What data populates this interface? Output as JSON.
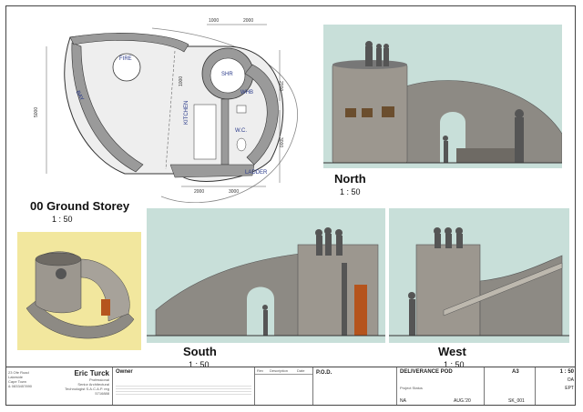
{
  "views": {
    "plan": {
      "title": "00 Ground Storey",
      "scale": "1 : 50"
    },
    "north": {
      "title": "North",
      "scale": "1 : 50"
    },
    "south": {
      "title": "South",
      "scale": "1 : 50"
    },
    "west": {
      "title": "West",
      "scale": "1 : 50"
    }
  },
  "plan_labels": {
    "fire": "FIRE",
    "shr": "SHR",
    "whb": "WHB",
    "wc": "W.C.",
    "kitchen": "KITCHEN",
    "ladder": "LADDER",
    "bay": "BAY"
  },
  "plan_dims": {
    "d1000_top": "1000",
    "d2000_top": "2000",
    "d1000_left": "1000",
    "d2000_right": "2000",
    "d3000_right": "3000",
    "d5000_left": "5000",
    "d3000_bottom": "3000",
    "d2000_bottom": "2000"
  },
  "title_block": {
    "name": "Eric Turck",
    "role1": "Professional",
    "role2": "Senior Architectural",
    "role3": "Technologist S.A.C.A.P. reg",
    "reg_no": "5716888",
    "address": [
      "23 Ofe Road",
      "Lakeside",
      "Cape Town",
      "& 0833457890"
    ],
    "owner_label": "Owner",
    "rev_headers": [
      "Rev",
      "Description",
      "Date"
    ],
    "client": "P.O.D.",
    "project": "DELIVERANCE POD",
    "project_status_label": "Project Status",
    "project_status": "NA",
    "date": "AUG.'20",
    "sheet_size": "A3",
    "scale": "1 : 50",
    "drawn": "OA",
    "checked": "EPT",
    "drawing_no": "SK_001"
  },
  "colors": {
    "sky": "#c8dfd9",
    "stone": "#8d8a84",
    "render_bg": "#f2e79e"
  }
}
